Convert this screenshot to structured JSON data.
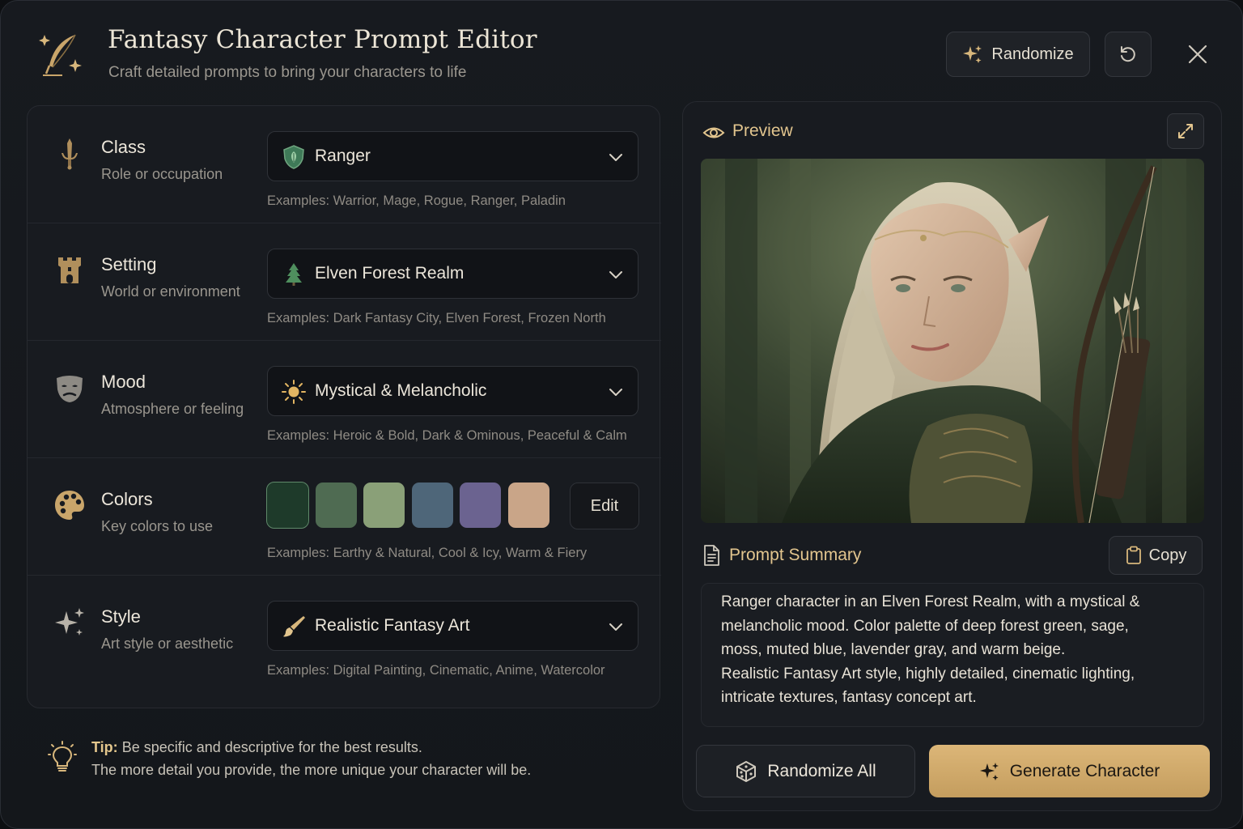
{
  "header": {
    "title": "Fantasy Character Prompt Editor",
    "subtitle": "Craft detailed prompts to bring your characters to life",
    "randomize_label": "Randomize",
    "icons": [
      "quill-sparkle-icon",
      "sparkle-icon",
      "undo-icon",
      "close-icon"
    ]
  },
  "fields": [
    {
      "label": "Class",
      "description": "Role or occupation",
      "value": "Ranger",
      "examples": "Examples: Warrior, Mage, Rogue, Ranger, Paladin",
      "icon": "sword-icon",
      "value_icon": "shield-leaf-icon"
    },
    {
      "label": "Setting",
      "description": "World or environment",
      "value": "Elven Forest Realm",
      "examples": "Examples: Dark Fantasy City, Elven Forest, Frozen North",
      "icon": "castle-tower-icon",
      "value_icon": "pine-tree-icon"
    },
    {
      "label": "Mood",
      "description": "Atmosphere or feeling",
      "value": "Mystical & Melancholic",
      "examples": "Examples: Heroic & Bold, Dark & Ominous, Peaceful & Calm",
      "icon": "mask-icon",
      "value_icon": "sun-icon"
    },
    {
      "label": "Colors",
      "description": "Key colors to use",
      "edit_label": "Edit",
      "examples": "Examples: Earthy & Natural, Cool & Icy, Warm & Fiery",
      "icon": "palette-icon",
      "swatches": [
        "#1e3a2a",
        "#4f6b52",
        "#8aa078",
        "#4e6679",
        "#6b6390",
        "#c9a588"
      ]
    },
    {
      "label": "Style",
      "description": "Art style or aesthetic",
      "value": "Realistic Fantasy Art",
      "examples": "Examples: Digital Painting, Cinematic, Anime, Watercolor",
      "icon": "sparkles-icon",
      "value_icon": "paintbrush-icon"
    }
  ],
  "tip": {
    "bold": "Tip:",
    "line1": "Be specific and descriptive for the best results.",
    "line2": "The more detail you provide, the more unique your character will be.",
    "icon": "lightbulb-icon"
  },
  "preview": {
    "title": "Preview",
    "icons": [
      "eye-icon",
      "expand-icon"
    ],
    "image": "elf-ranger-portrait"
  },
  "summary": {
    "title": "Prompt Summary",
    "copy_label": "Copy",
    "text": "Ranger character in an Elven Forest Realm, with a mystical &\nmelancholic mood. Color palette of deep forest green, sage,\nmoss, muted blue, lavender gray, and warm beige.\nRealistic Fantasy Art style, highly detailed, cinematic lighting,\nintricate textures, fantasy concept art."
  },
  "actions": {
    "randomize_all_label": "Randomize All",
    "generate_label": "Generate Character"
  },
  "colors": {
    "accent": "#e2c58e",
    "background": "#14171b",
    "panel": "#181b20"
  }
}
